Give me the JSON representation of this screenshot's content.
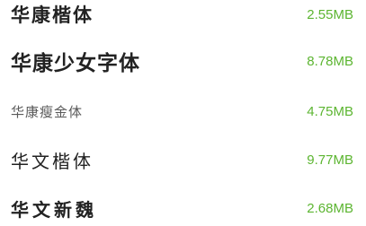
{
  "font_list": {
    "items": [
      {
        "name": "华康楷体",
        "size": "2.55MB"
      },
      {
        "name": "华康少女字体",
        "size": "8.78MB"
      },
      {
        "name": "华康瘦金体",
        "size": "4.75MB"
      },
      {
        "name": "华文楷体",
        "size": "9.77MB"
      },
      {
        "name": "华文新魏",
        "size": "2.68MB"
      }
    ]
  },
  "colors": {
    "size_text": "#5cb531",
    "name_text": "#222222",
    "background": "#ffffff"
  }
}
